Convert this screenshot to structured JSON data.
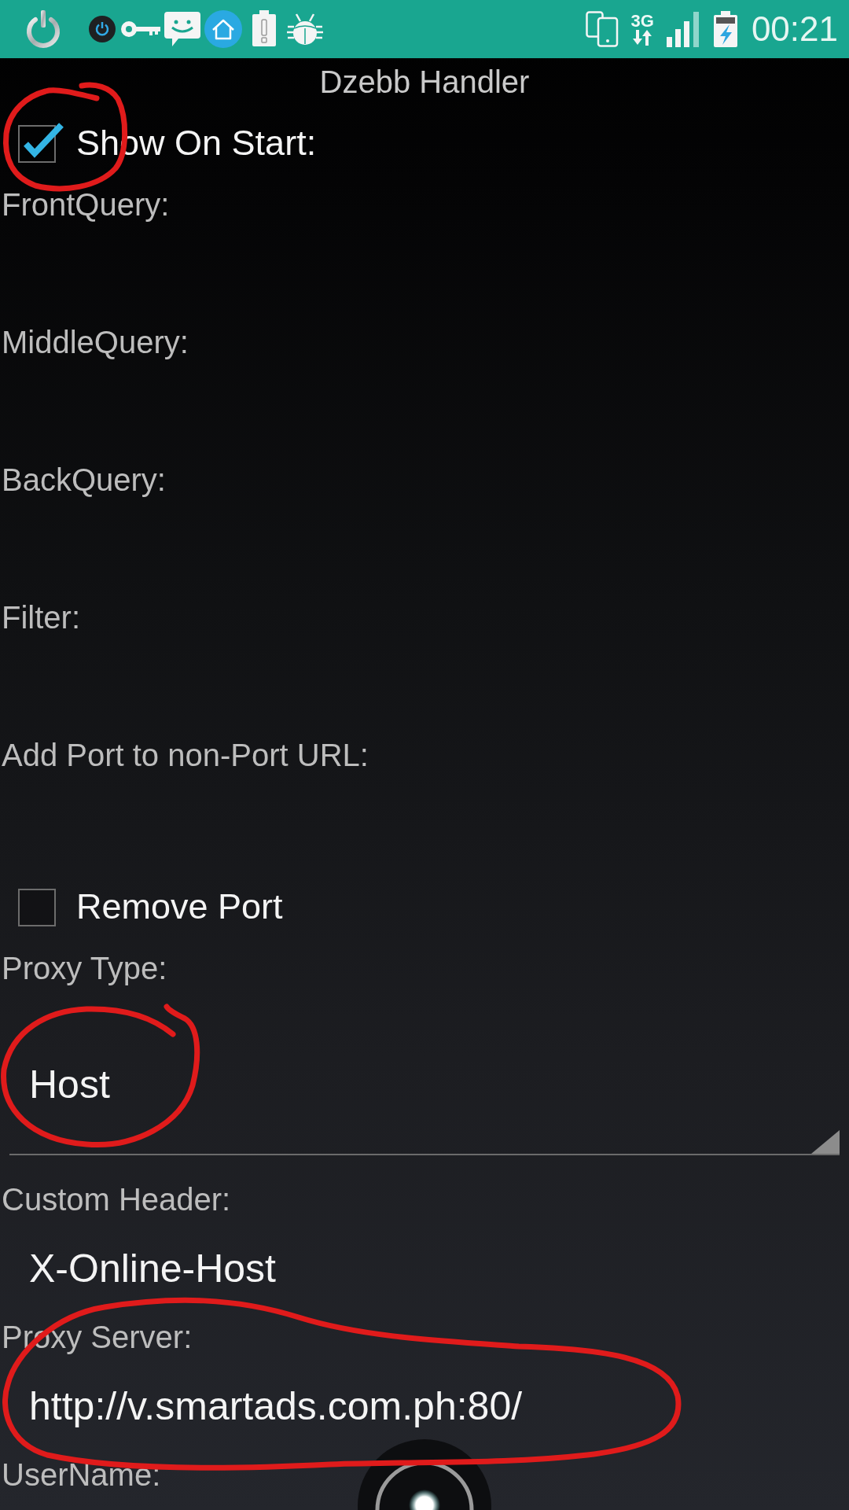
{
  "status_bar": {
    "network": "3G",
    "time": "00:21"
  },
  "title": "Dzebb Handler",
  "form": [
    {
      "kind": "checkbox",
      "label": "Show On Start:",
      "checked": true
    },
    {
      "kind": "text",
      "label": "FrontQuery:"
    },
    {
      "kind": "text",
      "label": "MiddleQuery:"
    },
    {
      "kind": "text",
      "label": "BackQuery:"
    },
    {
      "kind": "text",
      "label": "Filter:"
    },
    {
      "kind": "text",
      "label": "Add Port to non-Port URL:"
    },
    {
      "kind": "checkbox",
      "label": "Remove Port",
      "checked": false
    },
    {
      "kind": "dropdown",
      "label": "Proxy Type:",
      "value": "Host"
    },
    {
      "kind": "text",
      "label": "Custom Header:",
      "value": "X-Online-Host"
    },
    {
      "kind": "text",
      "label": "Proxy Server:",
      "value": "http://v.smartads.com.ph:80/"
    },
    {
      "kind": "text",
      "label": "UserName:"
    }
  ]
}
